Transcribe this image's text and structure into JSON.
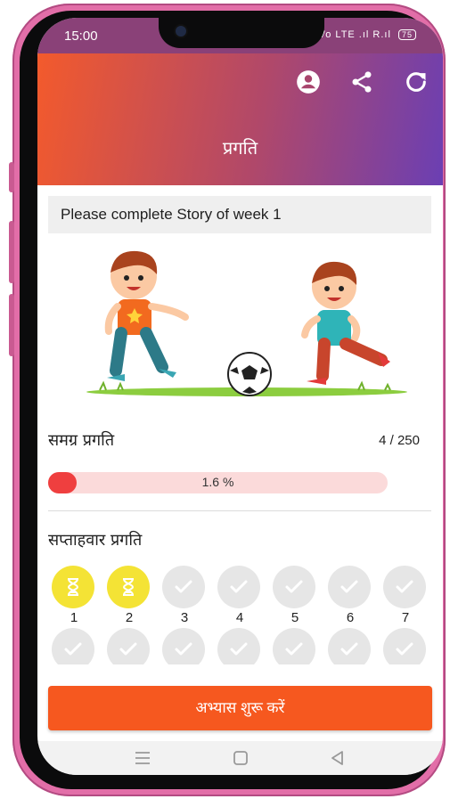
{
  "status_bar": {
    "time": "15:00",
    "network": "Vo LTE .ıl R.ıl",
    "battery": "75"
  },
  "header": {
    "title": "प्रगति",
    "icons": [
      "account-circle-icon",
      "share-icon",
      "refresh-icon"
    ]
  },
  "banner": {
    "text": "Please complete Story of week 1"
  },
  "overall": {
    "title": "समग्र प्रगति",
    "count": "4 / 250",
    "percent_label": "1.6 %",
    "percent_value": 1.6
  },
  "weekly": {
    "title": "सप्ताहवार प्रगति",
    "weeks": [
      {
        "label": "1",
        "state": "in-progress"
      },
      {
        "label": "2",
        "state": "in-progress"
      },
      {
        "label": "3",
        "state": "locked"
      },
      {
        "label": "4",
        "state": "locked"
      },
      {
        "label": "5",
        "state": "locked"
      },
      {
        "label": "6",
        "state": "locked"
      },
      {
        "label": "7",
        "state": "locked"
      }
    ]
  },
  "cta": {
    "label": "अभ्यास शुरू करें"
  },
  "colors": {
    "accent": "#F6581F",
    "progress_fill": "#EF3F3F",
    "progress_track": "#FBDADA",
    "week_active": "#F4E335",
    "week_locked": "#E6E6E6"
  }
}
